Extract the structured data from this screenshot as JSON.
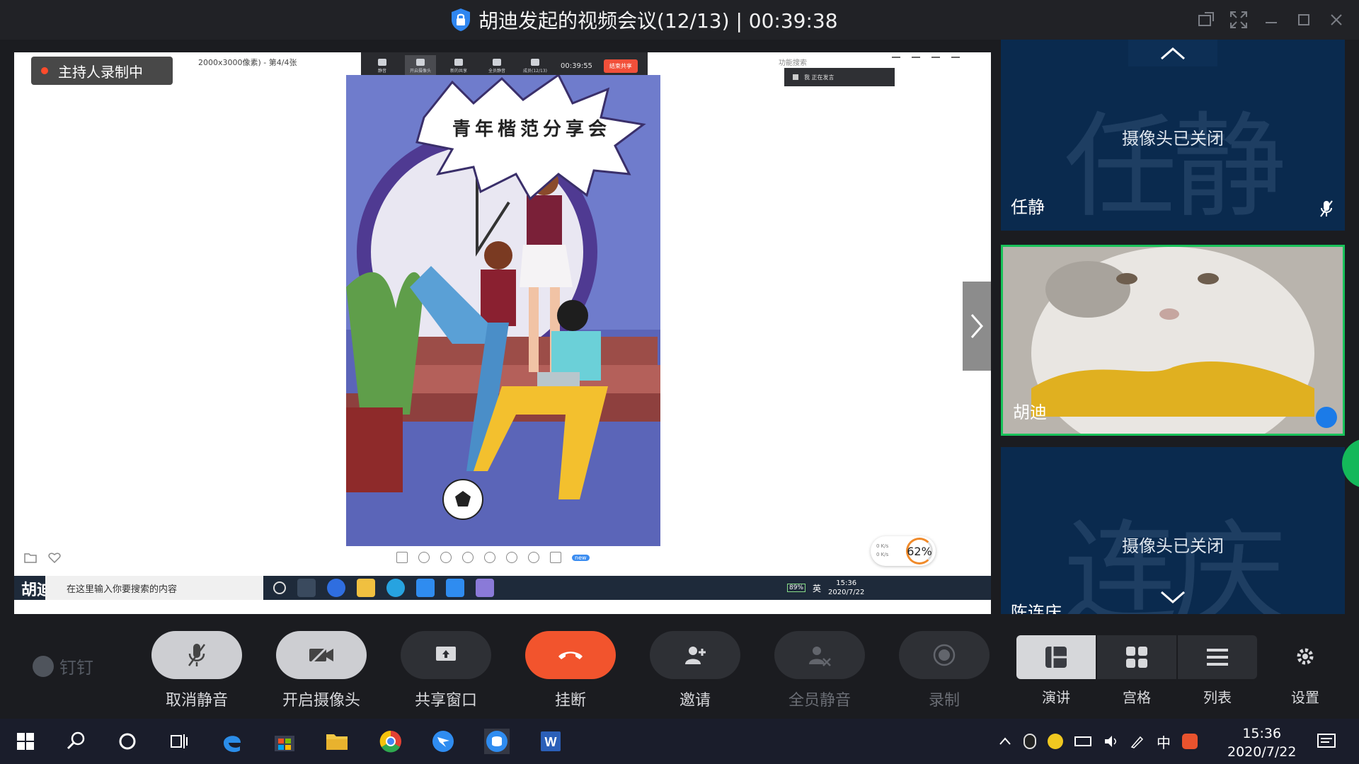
{
  "window": {
    "title": "胡迪发起的视频会议(12/13) | 00:39:38"
  },
  "share": {
    "recording_label": "主持人录制中",
    "file_info": "2000x3000像素) - 第4/4张",
    "toolbar_timer": "00:39:55",
    "toolbar_end": "结束共享",
    "toolbar_items": [
      "静音",
      "开启摄像头",
      "新的共享",
      "全员静音",
      "成员(12/13)"
    ],
    "search_placeholder": "功能搜索",
    "speaking_label": "我  正在发言",
    "poster_title": "青年楷范分享会",
    "zoom_percent": "62%",
    "net_speed": [
      "0 K/s",
      "0 K/s"
    ],
    "new_badge": "new"
  },
  "inner_taskbar": {
    "name_fragment": "胡迪",
    "search_placeholder": "在这里输入你要搜索的内容",
    "battery": "89%",
    "ime": "英",
    "time": "15:36",
    "date": "2020/7/22"
  },
  "participants": [
    {
      "name": "任静",
      "big": "任静",
      "status": "摄像头已关闭"
    },
    {
      "name": "胡迪",
      "status": ""
    },
    {
      "name": "陈连庆",
      "big": "连庆",
      "status": "摄像头已关闭"
    }
  ],
  "brand": "钉钉",
  "controls": {
    "unmute": "取消静音",
    "camera": "开启摄像头",
    "share": "共享窗口",
    "hangup": "挂断",
    "invite": "邀请",
    "mute_all": "全员静音",
    "record": "录制",
    "layout_speaker": "演讲",
    "layout_grid": "宫格",
    "layout_list": "列表",
    "settings": "设置"
  },
  "taskbar": {
    "ime": "中",
    "time": "15:36",
    "date": "2020/7/22"
  },
  "colors": {
    "accent_red": "#f2542d",
    "active_speaker_border": "#19c25a",
    "tile_bg": "#0a2a4e"
  }
}
